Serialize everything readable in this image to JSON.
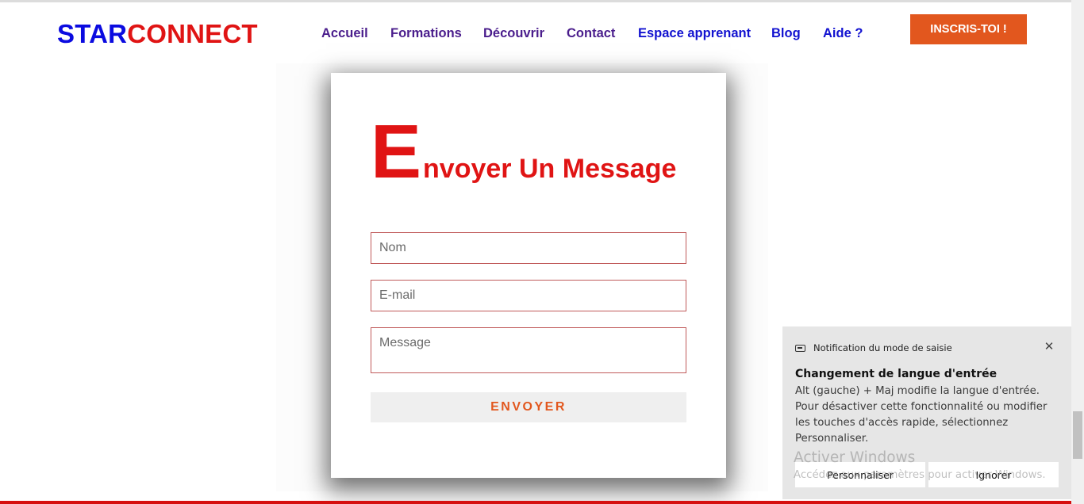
{
  "header": {
    "logo_part1": "STAR",
    "logo_part2": "CONNECT",
    "nav": [
      "Accueil",
      "Formations",
      "Découvrir",
      "Contact",
      "Espace apprenant",
      "Blog",
      "Aide ?"
    ],
    "cta_label": "INSCRIS-TOI !"
  },
  "form": {
    "title_initial": "E",
    "title_rest": "nvoyer Un Message",
    "name_placeholder": "Nom",
    "email_placeholder": "E-mail",
    "message_placeholder": "Message",
    "submit_label": "ENVOYER"
  },
  "notification": {
    "header": "Notification du mode de saisie",
    "title": "Changement de langue d'entrée",
    "body": "Alt (gauche) + Maj modifie la langue d'entrée. Pour désactiver cette fonctionnalité ou modifier les touches d'accès rapide, sélectionnez Personnaliser.",
    "btn_customize": "Personnaliser",
    "btn_ignore": "Ignorer",
    "close_icon": "close-icon"
  },
  "watermark": {
    "title": "Activer Windows",
    "subtitle": "Accédez aux paramètres pour activer Windows."
  },
  "colors": {
    "logo_blue": "#0b0be0",
    "brand_red": "#e01414",
    "accent_orange": "#e2571e",
    "nav_purple": "#4a1d8c",
    "nav_blue": "#1212d0"
  }
}
